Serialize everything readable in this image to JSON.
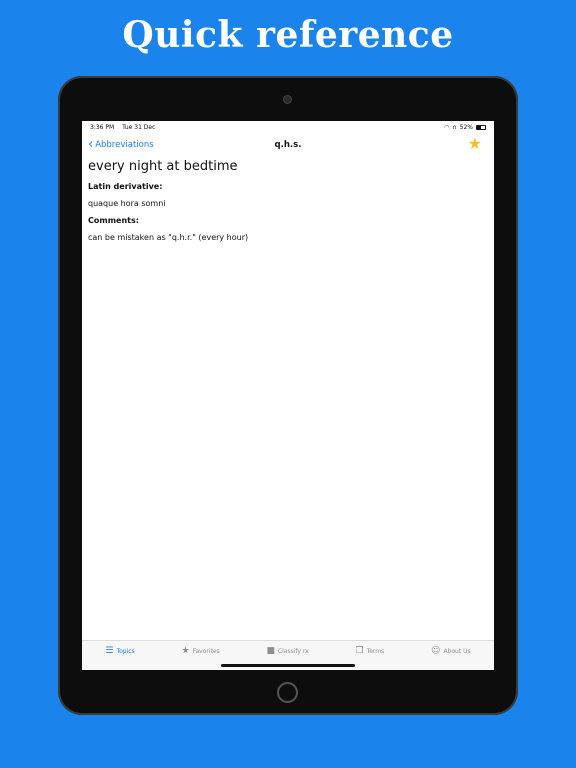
{
  "headline": "Quick reference",
  "status_bar": {
    "time": "3:36 PM",
    "date": "Tue 31 Dec",
    "battery": "52%",
    "battery_level": 0.52
  },
  "nav": {
    "back_label": "Abbreviations",
    "title": "q.h.s."
  },
  "entry": {
    "title": "every night at bedtime",
    "latin_label": "Latin derivative:",
    "latin_value": "quaque hora somni",
    "comments_label": "Comments:",
    "comments_value": "can be mistaken as \"q.h.r.\" (every hour)"
  },
  "tabs": [
    {
      "label": "Topics",
      "icon": "list-icon",
      "active": true
    },
    {
      "label": "Favorites",
      "icon": "star-icon",
      "active": false
    },
    {
      "label": "Classify rx",
      "icon": "bag-icon",
      "active": false
    },
    {
      "label": "Terms",
      "icon": "documents-icon",
      "active": false
    },
    {
      "label": "About Us",
      "icon": "person-icon",
      "active": false
    }
  ],
  "colors": {
    "background": "#1b84ec",
    "accent": "#1a7cf0",
    "star": "#f2c12e"
  }
}
